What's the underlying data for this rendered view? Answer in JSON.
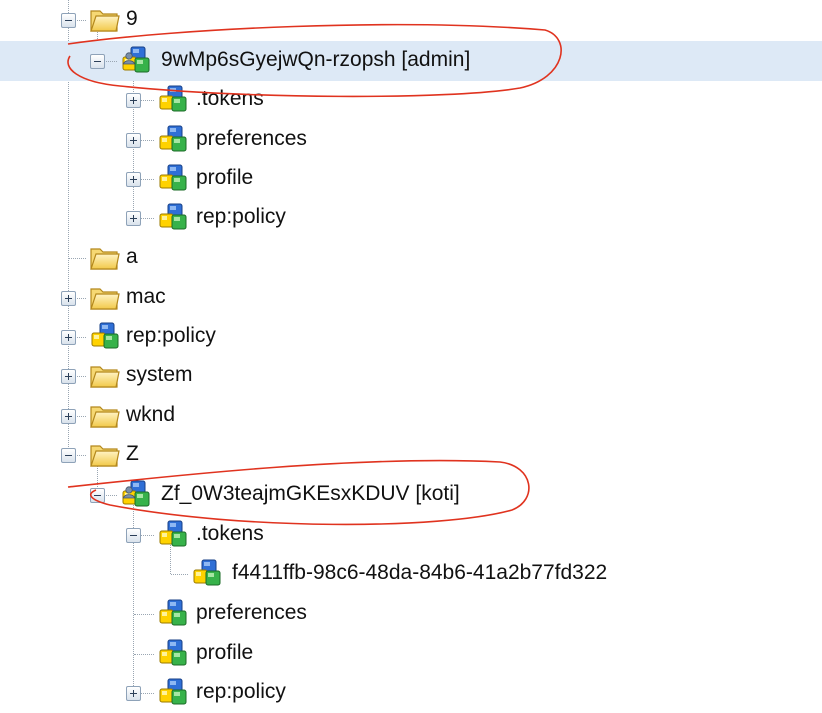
{
  "colors": {
    "selection_bg": "#dde9f6",
    "annotation_stroke": "#e0331f",
    "tree_line": "#9aa6b2"
  },
  "tree": {
    "rows": [
      {
        "label": "9",
        "icon": "folder-icon",
        "toggle": "collapse"
      },
      {
        "label": "9wMp6sGyejwQn-rzopsh [admin]",
        "icon": "user-node-icon",
        "toggle": "collapse",
        "selected": true
      },
      {
        "label": ".tokens",
        "icon": "node-icon",
        "toggle": "expand"
      },
      {
        "label": "preferences",
        "icon": "node-icon",
        "toggle": "expand"
      },
      {
        "label": "profile",
        "icon": "node-icon",
        "toggle": "expand"
      },
      {
        "label": "rep:policy",
        "icon": "node-icon",
        "toggle": "expand"
      },
      {
        "label": "a",
        "icon": "folder-icon",
        "toggle": "none"
      },
      {
        "label": "mac",
        "icon": "folder-icon",
        "toggle": "expand"
      },
      {
        "label": "rep:policy",
        "icon": "node-icon",
        "toggle": "expand"
      },
      {
        "label": "system",
        "icon": "folder-icon",
        "toggle": "expand"
      },
      {
        "label": "wknd",
        "icon": "folder-icon",
        "toggle": "expand"
      },
      {
        "label": "Z",
        "icon": "folder-icon",
        "toggle": "collapse"
      },
      {
        "label": "Zf_0W3teajmGKEsxKDUV [koti]",
        "icon": "user-node-icon",
        "toggle": "collapse"
      },
      {
        "label": ".tokens",
        "icon": "node-icon",
        "toggle": "collapse"
      },
      {
        "label": "f4411ffb-98c6-48da-84b6-41a2b77fd322",
        "icon": "node-icon",
        "toggle": "none"
      },
      {
        "label": "preferences",
        "icon": "node-icon",
        "toggle": "none"
      },
      {
        "label": "profile",
        "icon": "node-icon",
        "toggle": "none"
      },
      {
        "label": "rep:policy",
        "icon": "node-icon",
        "toggle": "expand"
      }
    ]
  }
}
